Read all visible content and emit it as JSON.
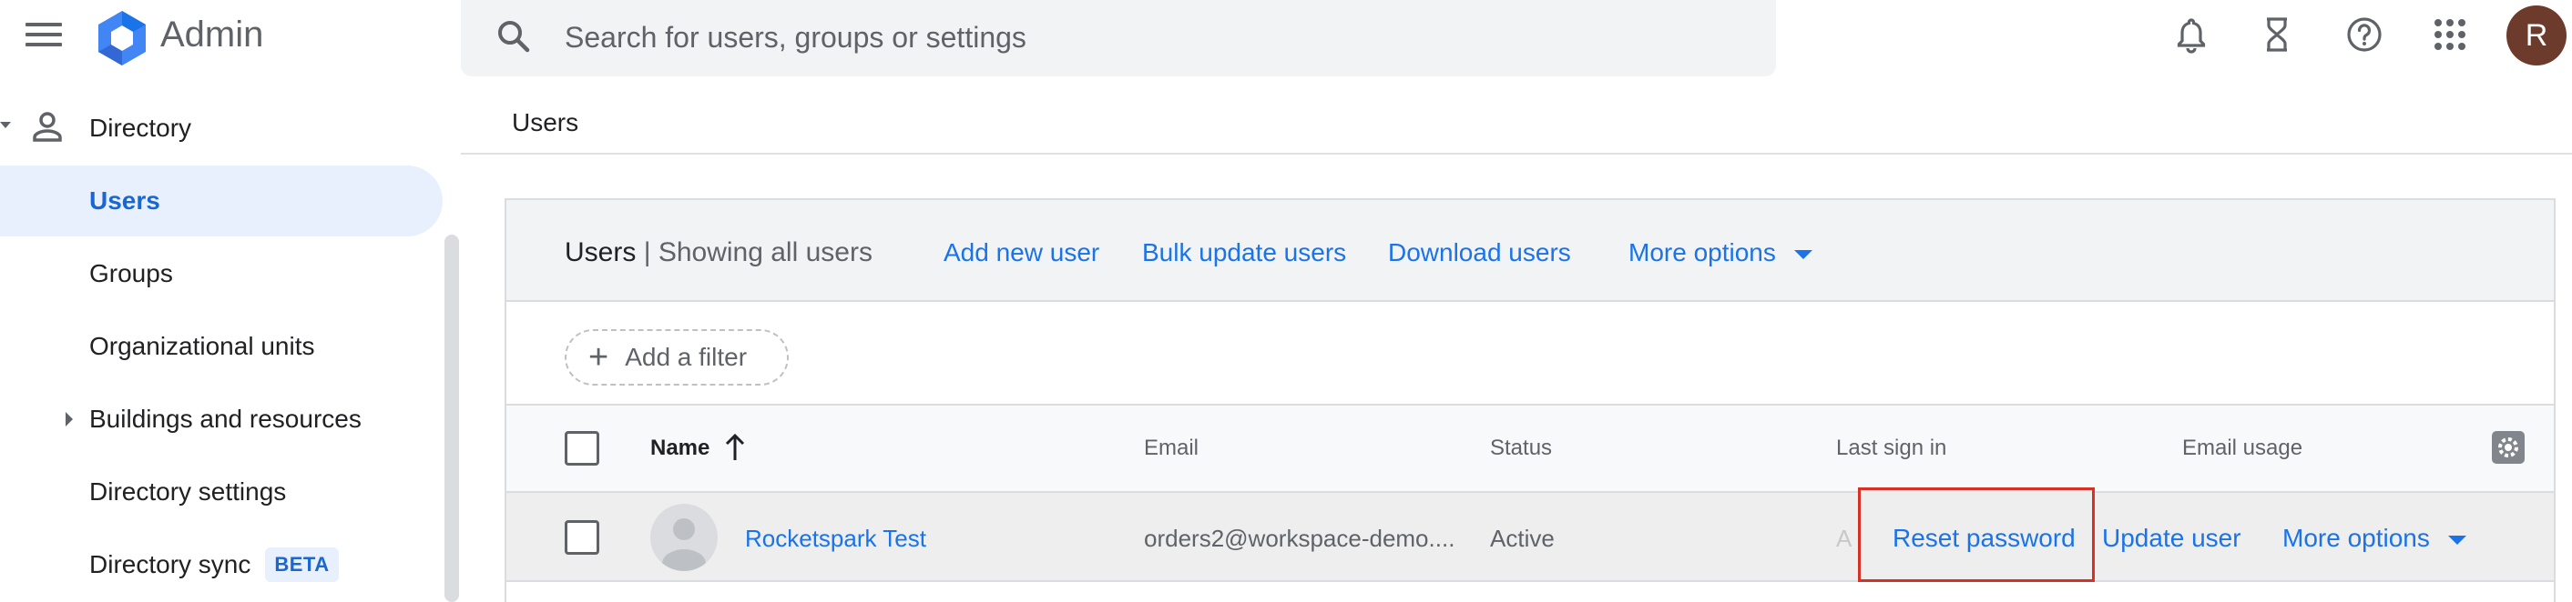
{
  "header": {
    "app_title": "Admin",
    "search_placeholder": "Search for users, groups or settings",
    "avatar_initial": "R",
    "icons": [
      "menu-icon",
      "admin-logo-icon",
      "search-icon",
      "notifications-icon",
      "tasks-hourglass-icon",
      "help-icon",
      "apps-grid-icon"
    ]
  },
  "sidebar": {
    "section_label": "Directory",
    "items": [
      {
        "label": "Users",
        "active": true
      },
      {
        "label": "Groups"
      },
      {
        "label": "Organizational units"
      },
      {
        "label": "Buildings and resources",
        "expandable": true
      },
      {
        "label": "Directory settings"
      },
      {
        "label": "Directory sync",
        "badge": "BETA"
      }
    ]
  },
  "main": {
    "breadcrumb": "Users",
    "toolbar": {
      "title": "Users",
      "subtitle": "| Showing all users",
      "add_new_user": "Add new user",
      "bulk_update": "Bulk update users",
      "download": "Download users",
      "more_options": "More options"
    },
    "filter": {
      "add_filter_label": "Add a filter"
    },
    "table": {
      "columns": [
        "Name",
        "Email",
        "Status",
        "Last sign in",
        "Email usage"
      ],
      "rows": [
        {
          "name": "Rocketspark Test",
          "email": "orders2@workspace-demo....",
          "status": "Active",
          "last_sign_in_partial": "A",
          "actions": {
            "reset_password": "Reset password",
            "update_user": "Update user",
            "more_options": "More options"
          }
        }
      ]
    }
  },
  "colors": {
    "accent": "#1a73e8",
    "active_nav_bg": "#e8f0fe",
    "highlight_border": "#d93025",
    "avatar_bg": "#6d3b2c"
  }
}
